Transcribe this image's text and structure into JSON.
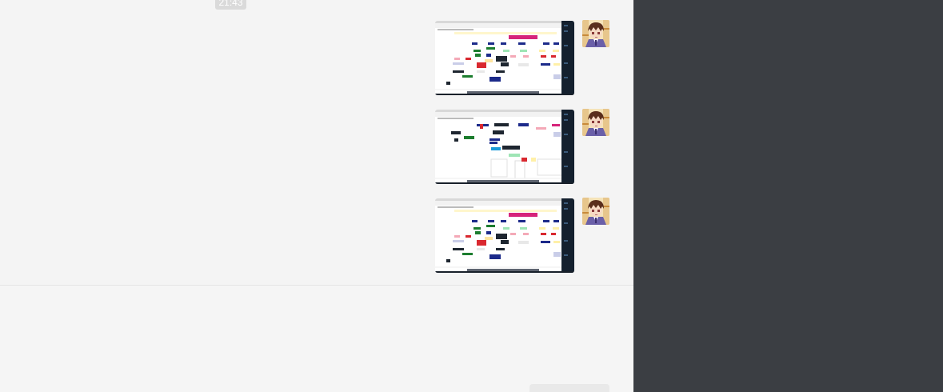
{
  "chat": {
    "timestamp": "21:43",
    "messages": [
      {
        "type": "image",
        "sender": "self",
        "thumbnail_variant": "flowchart-colorful"
      },
      {
        "type": "image",
        "sender": "self",
        "thumbnail_variant": "flowchart-sparse"
      },
      {
        "type": "image",
        "sender": "self",
        "thumbnail_variant": "flowchart-colorful"
      }
    ]
  },
  "composer": {
    "send_label": ""
  },
  "colors": {
    "chat_bg": "#f4f4f4",
    "side_panel": "#3b3e43",
    "timestamp_bg": "#dadada",
    "divider": "#e5e5e5"
  }
}
